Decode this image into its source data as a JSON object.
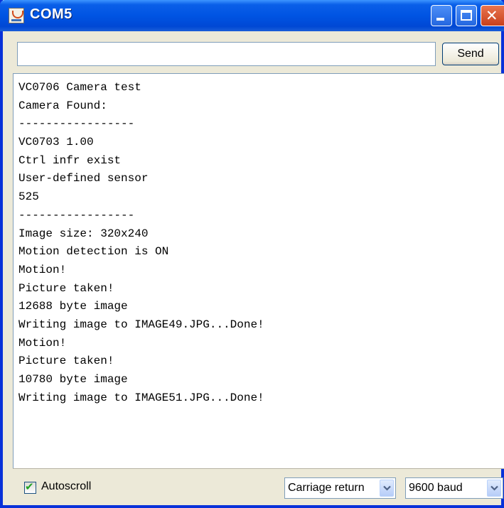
{
  "window": {
    "title": "COM5"
  },
  "input": {
    "value": "",
    "placeholder": ""
  },
  "send_label": "Send",
  "output_lines": [
    "VC0706 Camera test",
    "Camera Found:",
    "-----------------",
    "VC0703 1.00",
    "Ctrl infr exist",
    "User-defined sensor",
    "525",
    "-----------------",
    "Image size: 320x240",
    "Motion detection is ON",
    "Motion!",
    "Picture taken!",
    "12688 byte image",
    "Writing image to IMAGE49.JPG...Done!",
    "Motion!",
    "Picture taken!",
    "10780 byte image",
    "Writing image to IMAGE51.JPG...Done!"
  ],
  "statusbar": {
    "autoscroll": {
      "label": "Autoscroll",
      "checked": true
    },
    "line_ending": "Carriage return",
    "baud_rate": "9600 baud"
  },
  "icons": {
    "app": "serial-monitor-icon",
    "minimize": "minimize-icon",
    "maximize": "maximize-icon",
    "close": "close-icon",
    "check": "check-icon",
    "dropdown": "chevron-down-icon"
  },
  "colors": {
    "titlebar": "#0054e3",
    "close_button": "#d8552f",
    "window_border": "#0831d9",
    "check": "#21a121"
  }
}
